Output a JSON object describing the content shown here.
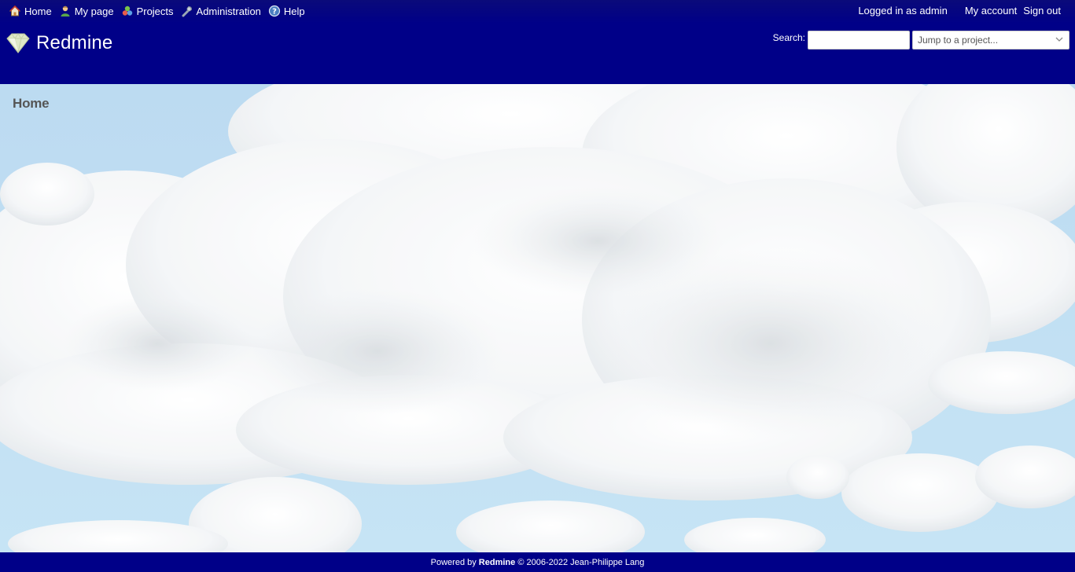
{
  "top_menu": {
    "left": [
      {
        "label": "Home",
        "icon": "home-icon"
      },
      {
        "label": "My page",
        "icon": "user-icon"
      },
      {
        "label": "Projects",
        "icon": "projects-icon"
      },
      {
        "label": "Administration",
        "icon": "wrench-icon"
      },
      {
        "label": "Help",
        "icon": "help-icon"
      }
    ],
    "logged_in_as": "Logged in as admin",
    "my_account": "My account",
    "sign_out": "Sign out"
  },
  "header": {
    "app_title": "Redmine",
    "search_label": "Search:",
    "search_value": "",
    "jump_placeholder": "Jump to a project..."
  },
  "main": {
    "page_title": "Home",
    "background": "sky-with-clouds"
  },
  "footer": {
    "powered_by": "Powered by",
    "brand": "Redmine",
    "copyright": "© 2006-2022 Jean-Philippe Lang"
  },
  "colors": {
    "header_bg": "#000088",
    "title_text": "#555555"
  }
}
